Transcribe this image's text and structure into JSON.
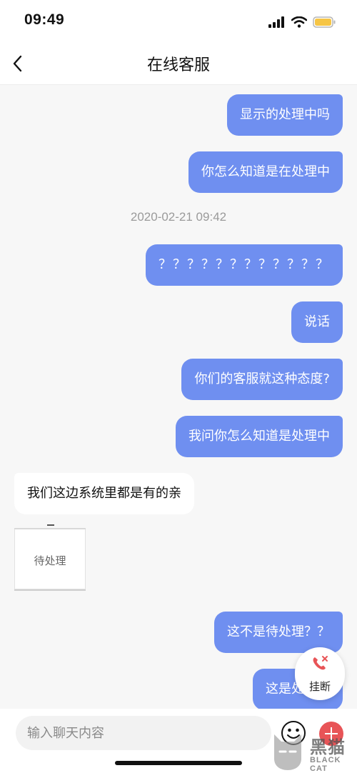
{
  "status_bar": {
    "time": "09:49"
  },
  "nav": {
    "title": "在线客服"
  },
  "messages": [
    {
      "text": "显示的处理中吗"
    },
    {
      "text": "你怎么知道是在处理中"
    },
    {
      "text": "？？？？？？？？？？？？"
    },
    {
      "text": "说话"
    },
    {
      "text": "你们的客服就这种态度?"
    },
    {
      "text": "我问你怎么知道是处理中"
    },
    {
      "text": "我们这边系统里都是有的亲"
    },
    {
      "text": "这不是待处理？？"
    },
    {
      "text": "这是处理中"
    }
  ],
  "timestamp": "2020-02-21 09:42",
  "image_message": {
    "label": "待处理"
  },
  "hangup": {
    "label": "挂断"
  },
  "input": {
    "placeholder": "输入聊天内容"
  },
  "watermark": {
    "title": "黑猫",
    "subtitle": "BLACK CAT"
  },
  "colors": {
    "outgoing_bubble": "#6f8ff0",
    "hangup_icon": "#e85457"
  }
}
